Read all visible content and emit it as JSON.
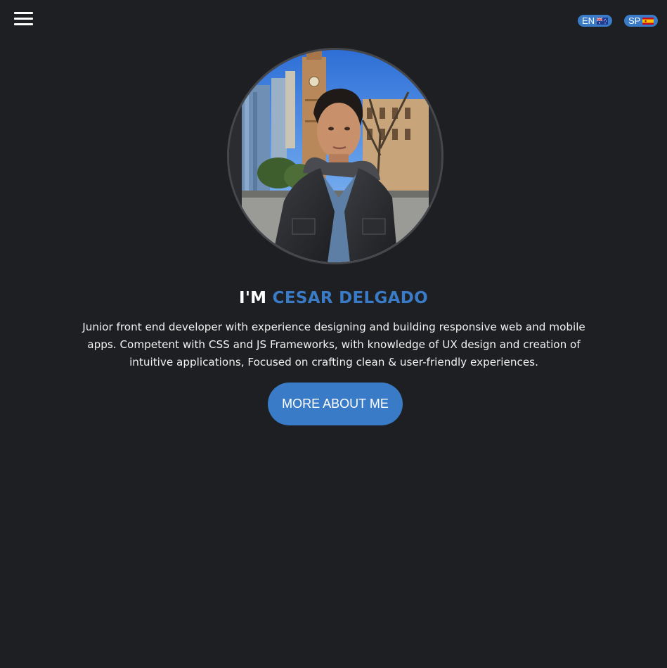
{
  "nav": {
    "menu_icon": "hamburger-menu-icon",
    "languages": [
      {
        "label": "EN",
        "flag_icon": "australia-flag-icon"
      },
      {
        "label": "SP",
        "flag_icon": "spain-flag-icon"
      }
    ]
  },
  "hero": {
    "avatar_alt": "profile-photo",
    "headline_prefix": "I'M ",
    "headline_name": "CESAR DELGADO",
    "bio": "Junior front end developer with experience designing and building responsive web and mobile apps. Competent with CSS and JS Frameworks, with knowledge of UX design and creation of intuitive applications, Focused on crafting clean & user-friendly experiences.",
    "cta_label": "MORE ABOUT ME"
  },
  "colors": {
    "background": "#1e1f22",
    "accent": "#3a7bc8",
    "text": "#ffffff"
  }
}
